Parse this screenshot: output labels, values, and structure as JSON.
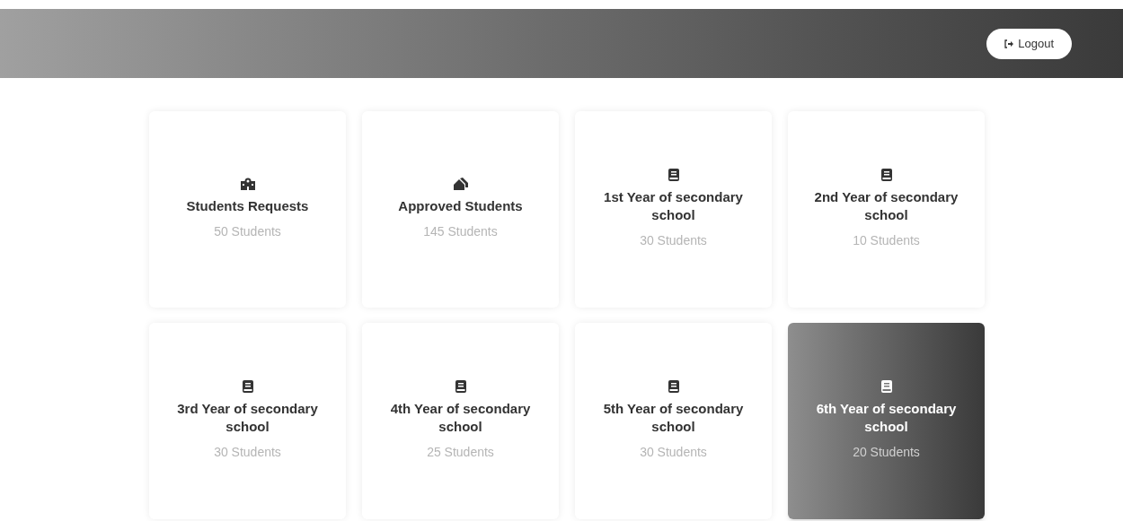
{
  "header": {
    "logout": {
      "label": "Logout"
    }
  },
  "cards": [
    {
      "kind": "school",
      "title": "Students Requests",
      "count": "50 Students",
      "selected": false
    },
    {
      "kind": "houses",
      "title": "Approved Students",
      "count": "145 Students",
      "selected": false
    },
    {
      "kind": "book",
      "title": "1st Year of secondary school",
      "count": "30 Students",
      "selected": false
    },
    {
      "kind": "book",
      "title": "2nd Year of secondary school",
      "count": "10 Students",
      "selected": false
    },
    {
      "kind": "book",
      "title": "3rd Year of secondary school",
      "count": "30 Students",
      "selected": false
    },
    {
      "kind": "book",
      "title": "4th Year of secondary school",
      "count": "25 Students",
      "selected": false
    },
    {
      "kind": "book",
      "title": "5th Year of secondary school",
      "count": "30 Students",
      "selected": false
    },
    {
      "kind": "book",
      "title": "6th Year of secondary school",
      "count": "20 Students",
      "selected": true
    }
  ]
}
